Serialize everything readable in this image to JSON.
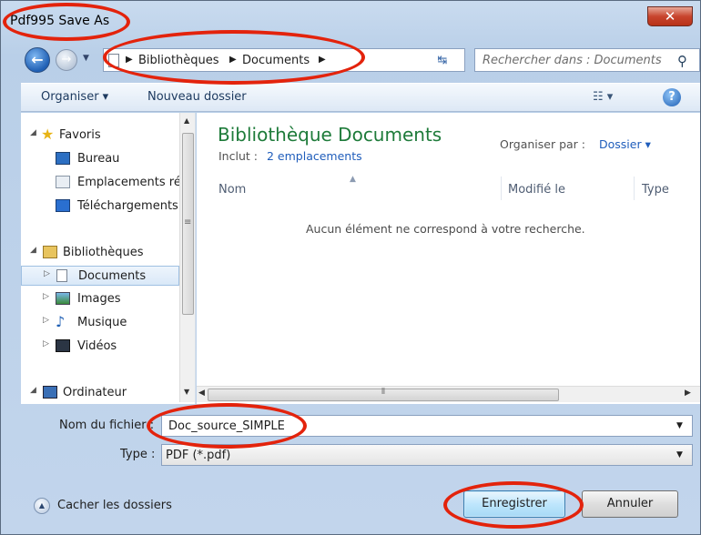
{
  "window": {
    "title": "Pdf995 Save As",
    "close_label": "✕"
  },
  "navbar": {
    "breadcrumbs": [
      "Bibliothèques",
      "Documents"
    ],
    "search_placeholder": "Rechercher dans : Documents"
  },
  "toolbar": {
    "organise_label": "Organiser ▾",
    "new_folder_label": "Nouveau dossier",
    "view_label": "☷ ▾",
    "help_label": "?"
  },
  "nav_pane": {
    "items": [
      {
        "label": "Favoris",
        "icon": "star-icon",
        "arrow": "◢"
      },
      {
        "label": "Bureau",
        "icon": "desktop-icon",
        "arrow": ""
      },
      {
        "label": "Emplacements ré",
        "icon": "recent-places-icon",
        "arrow": ""
      },
      {
        "label": "Téléchargements",
        "icon": "downloads-icon",
        "arrow": ""
      },
      {
        "label": "Bibliothèques",
        "icon": "libraries-icon",
        "arrow": "◢"
      },
      {
        "label": "Documents",
        "icon": "documents-icon",
        "arrow": "▷",
        "selected": true
      },
      {
        "label": "Images",
        "icon": "images-icon",
        "arrow": "▷"
      },
      {
        "label": "Musique",
        "icon": "music-icon",
        "arrow": "▷"
      },
      {
        "label": "Vidéos",
        "icon": "videos-icon",
        "arrow": "▷"
      },
      {
        "label": "Ordinateur",
        "icon": "computer-icon",
        "arrow": "◢"
      }
    ]
  },
  "content": {
    "title": "Bibliothèque Documents",
    "included_label": "Inclut :",
    "included_link": "2 emplacements",
    "organise_by_label": "Organiser par :",
    "organise_by_value": "Dossier ▾",
    "columns": [
      "Nom",
      "Modifié le",
      "Type"
    ],
    "empty_message": "Aucun élément ne correspond à votre recherche."
  },
  "form": {
    "filename_label": "Nom du fichier :",
    "filename_value": "Doc_source_SIMPLE",
    "type_label": "Type :",
    "type_value": "PDF (*.pdf)"
  },
  "footer": {
    "hide_folders_label": "Cacher les dossiers",
    "save_label": "Enregistrer",
    "cancel_label": "Annuler"
  },
  "annotation_color": "#e3230c"
}
